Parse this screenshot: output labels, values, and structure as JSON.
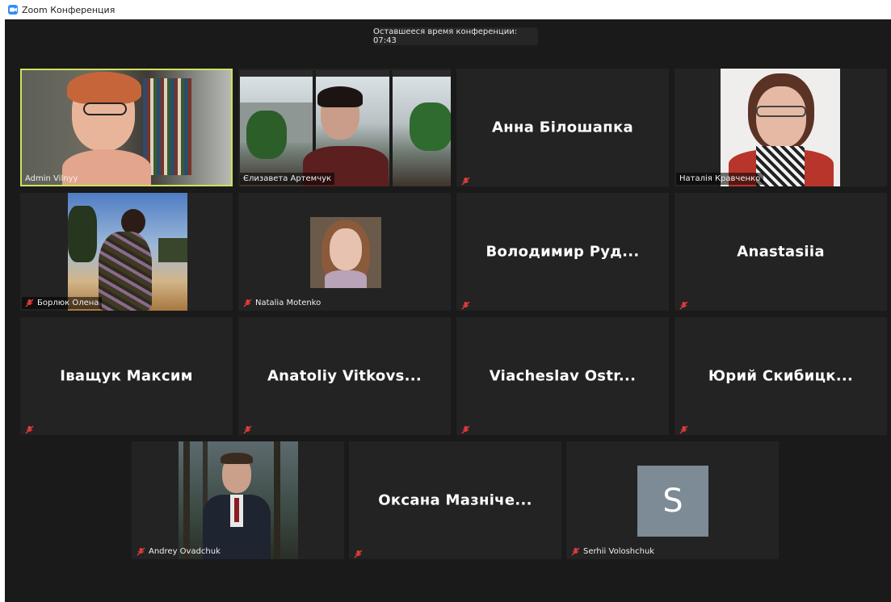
{
  "window": {
    "title": "Zoom Конференция",
    "app_icon": "zoom-camera-icon"
  },
  "meeting": {
    "remaining_time": "Оставшееся время конференции: 07:43"
  },
  "colors": {
    "stage": "#1a1a1a",
    "tile": "#232323",
    "active_border": "#cde35a",
    "mute_red": "#e03b3b",
    "avatar_bg": "#7c8b96"
  },
  "participants": [
    {
      "name": "Admin Vilnyy",
      "video": true,
      "muted": false,
      "active_speaker": true
    },
    {
      "name": "Єлизавета Артемчук",
      "video": true,
      "muted": false
    },
    {
      "name": "Анна Білошапка",
      "video": false,
      "muted": true
    },
    {
      "name": "Наталія Кравченко",
      "video": true,
      "muted": false
    },
    {
      "name": "Борлюк Олена",
      "video": true,
      "muted": true
    },
    {
      "name": "Natalia Motenko",
      "video": true,
      "muted": true
    },
    {
      "name": "Володимир Руд...",
      "video": false,
      "muted": true
    },
    {
      "name": "Anastasiia",
      "video": false,
      "muted": true
    },
    {
      "name": "Іващук Максим",
      "video": false,
      "muted": true
    },
    {
      "name": "Anatoliy Vitkovs...",
      "video": false,
      "muted": true
    },
    {
      "name": "Viacheslav Ostr...",
      "video": false,
      "muted": true
    },
    {
      "name": "Юрий Скибицк...",
      "video": false,
      "muted": true
    },
    {
      "name": "Andrey Ovadchuk",
      "video": true,
      "muted": true
    },
    {
      "name": "Оксана Мазніче...",
      "video": false,
      "muted": true
    },
    {
      "name": "Serhii Voloshchuk",
      "video": false,
      "muted": true,
      "avatar_letter": "S"
    }
  ]
}
